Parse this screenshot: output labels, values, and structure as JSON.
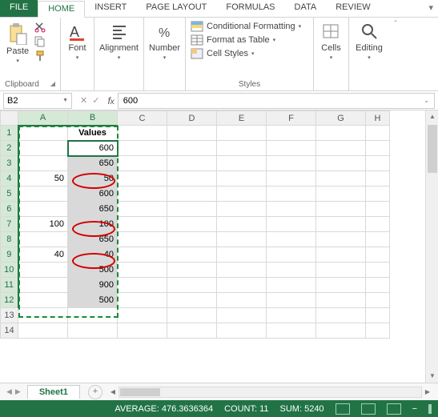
{
  "tabs": {
    "file": "FILE",
    "home": "HOME",
    "insert": "INSERT",
    "page_layout": "PAGE LAYOUT",
    "formulas": "FORMULAS",
    "data": "DATA",
    "review": "REVIEW"
  },
  "ribbon": {
    "clipboard": {
      "label": "Clipboard",
      "paste": "Paste"
    },
    "font": {
      "label": "Font"
    },
    "alignment": {
      "label": "Alignment"
    },
    "number": {
      "label": "Number"
    },
    "styles": {
      "label": "Styles",
      "cond_format": "Conditional Formatting",
      "as_table": "Format as Table",
      "cell_styles": "Cell Styles"
    },
    "cells": {
      "label": "Cells"
    },
    "editing": {
      "label": "Editing"
    }
  },
  "formula_bar": {
    "name_box": "B2",
    "formula": "600"
  },
  "columns": [
    "A",
    "B",
    "C",
    "D",
    "E",
    "F",
    "G",
    "H"
  ],
  "rows": [
    "1",
    "2",
    "3",
    "4",
    "5",
    "6",
    "7",
    "8",
    "9",
    "10",
    "11",
    "12",
    "13",
    "14"
  ],
  "header_cell": "Values",
  "dataA": {
    "r4": "50",
    "r7": "100",
    "r9": "40"
  },
  "dataB": {
    "r2": "600",
    "r3": "650",
    "r4": "50",
    "r5": "600",
    "r6": "650",
    "r7": "100",
    "r8": "650",
    "r9": "40",
    "r10": "500",
    "r11": "900",
    "r12": "500"
  },
  "sheet": {
    "name": "Sheet1"
  },
  "status": {
    "average_label": "AVERAGE:",
    "average_value": "476.3636364",
    "count_label": "COUNT:",
    "count_value": "11",
    "sum_label": "SUM:",
    "sum_value": "5240"
  }
}
